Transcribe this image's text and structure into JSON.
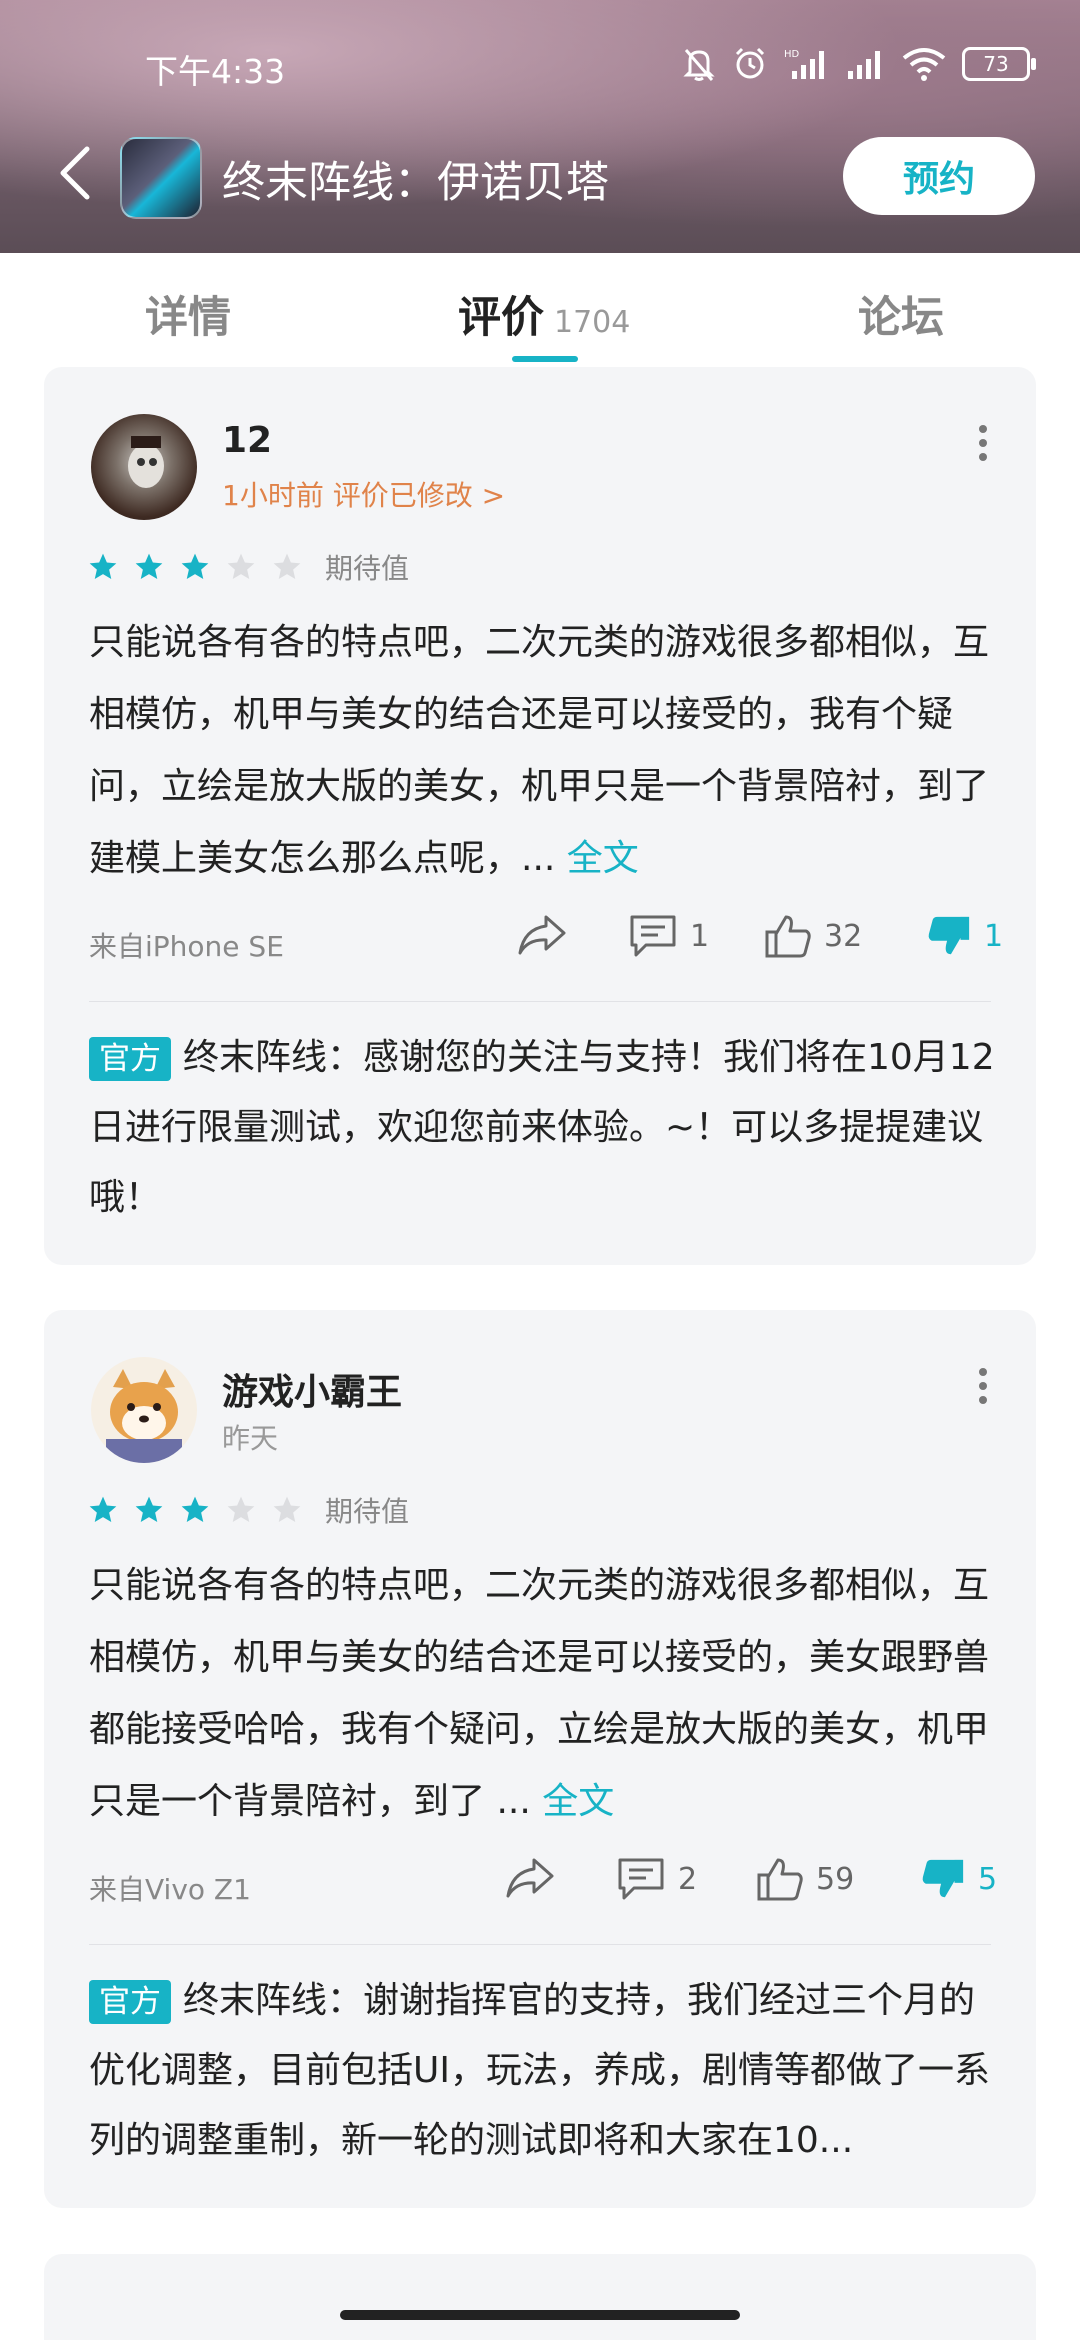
{
  "status": {
    "time": "下午4:33",
    "battery": "73"
  },
  "header": {
    "title": "终末阵线：伊诺贝塔",
    "reserve_label": "预约"
  },
  "tabs": [
    {
      "label": "详情"
    },
    {
      "label": "评价",
      "count": "1704"
    },
    {
      "label": "论坛"
    }
  ],
  "reviews": [
    {
      "user": "12",
      "meta": "1小时前 评价已修改 >",
      "rating": 3,
      "rating_label": "期待值",
      "text": "只能说各有各的特点吧，二次元类的游戏很多都相似，互相模仿，机甲与美女的结合还是可以接受的，我有个疑问，立绘是放大版的美女，机甲只是一个背景陪衬，到了建模上美女怎么那么点呢，...",
      "full_label": "全文",
      "device": "来自iPhone SE",
      "comments": "1",
      "likes": "32",
      "dislikes": "1",
      "official_badge": "官方",
      "official_reply": "终末阵线：感谢您的关注与支持！我们将在10月12日进行限量测试，欢迎您前来体验。~！可以多提提建议哦！"
    },
    {
      "user": "游戏小霸王",
      "meta": "昨天",
      "rating": 3,
      "rating_label": "期待值",
      "text": "只能说各有各的特点吧，二次元类的游戏很多都相似，互相模仿，机甲与美女的结合还是可以接受的，美女跟野兽都能接受哈哈，我有个疑问，立绘是放大版的美女，机甲只是一个背景陪衬，到了 ...",
      "full_label": "全文",
      "device": "来自Vivo Z1",
      "comments": "2",
      "likes": "59",
      "dislikes": "5",
      "official_badge": "官方",
      "official_reply": "终末阵线：谢谢指挥官的支持，我们经过三个月的优化调整，目前包括UI，玩法，养成，剧情等都做了一系列的调整重制，新一轮的测试即将和大家在10..."
    }
  ],
  "colors": {
    "accent": "#17b3c6",
    "meta_orange": "#e0834a"
  }
}
